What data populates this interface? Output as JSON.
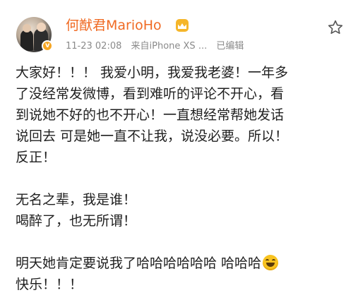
{
  "post": {
    "author": {
      "name": "何猷君MarioHo",
      "verified": true
    },
    "meta": {
      "time": "11-23 02:08",
      "source": "来自iPhone XS ...",
      "edited": "已编辑"
    },
    "content": {
      "p1": [
        "大家好！！！ 我爱小明，我爱我老婆！一年多",
        "了没经常发微博，看到难听的评论不开心，看",
        "到说她不好的也不开心！一直想经常帮她发话",
        "说回去 可是她一直不让我，说没必要。所以！",
        "反正！"
      ],
      "p2": [
        "无名之辈，我是谁！",
        "喝醉了，也无所谓！"
      ],
      "p3": [
        "明天她肯定要说我了哈哈哈哈哈哈 哈哈哈",
        "快乐！！！"
      ]
    }
  },
  "icons": {
    "vip": "crown-icon",
    "verified": "verified-badge-icon",
    "favorite": "star-outline-icon",
    "emoji": "grinning-face-emoji"
  },
  "colors": {
    "username": "#f06a23",
    "meta": "#8a8a8a",
    "text": "#1f1f1f",
    "verified": "#f6a623"
  }
}
